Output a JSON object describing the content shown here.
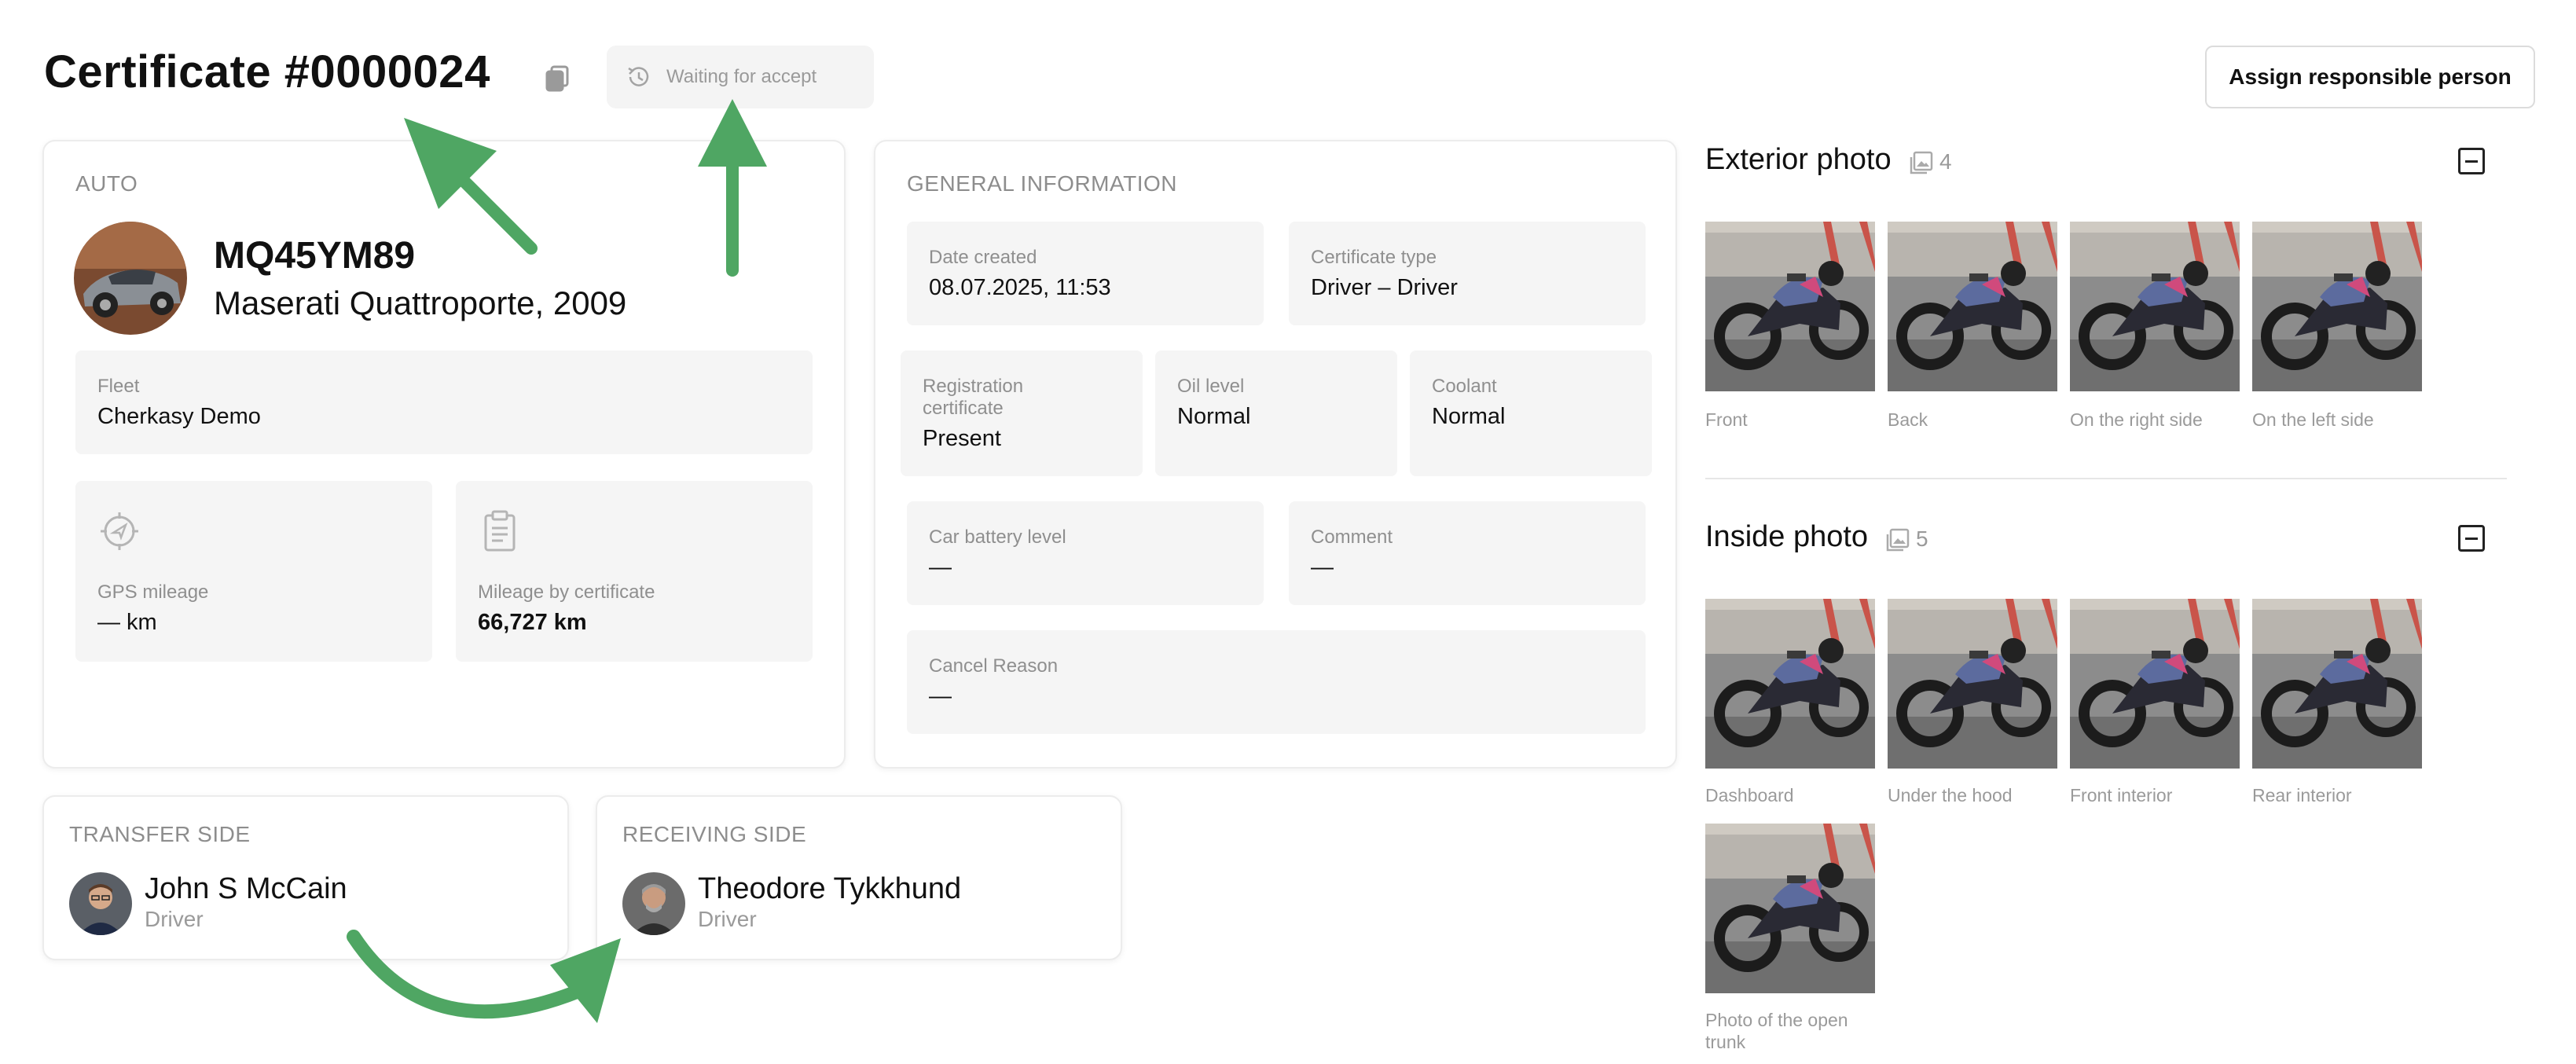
{
  "header": {
    "title": "Certificate #0000024",
    "status": "Waiting for accept",
    "assign_button": "Assign responsible person"
  },
  "auto": {
    "section_label": "AUTO",
    "plate": "MQ45YM89",
    "model": "Maserati Quattroporte, 2009",
    "fleet_label": "Fleet",
    "fleet_value": "Cherkasy Demo",
    "gps_label": "GPS mileage",
    "gps_value": "— km",
    "mileage_label": "Mileage by certificate",
    "mileage_value": "66,727 km"
  },
  "general": {
    "section_label": "GENERAL INFORMATION",
    "date_label": "Date created",
    "date_value": "08.07.2025, 11:53",
    "type_label": "Certificate type",
    "type_value": "Driver – Driver",
    "reg_label_1": "Registration",
    "reg_label_2": "certificate",
    "reg_value": "Present",
    "oil_label": "Oil level",
    "oil_value": "Normal",
    "coolant_label": "Coolant",
    "coolant_value": "Normal",
    "battery_label": "Car battery level",
    "battery_value": "—",
    "comment_label": "Comment",
    "comment_value": "—",
    "cancel_label": "Cancel Reason",
    "cancel_value": "—"
  },
  "transfer": {
    "section_label": "TRANSFER SIDE",
    "name": "John S McCain",
    "role": "Driver"
  },
  "receiving": {
    "section_label": "RECEIVING SIDE",
    "name": "Theodore Tykkhund",
    "role": "Driver"
  },
  "exterior": {
    "title": "Exterior photo",
    "count": "4",
    "photos": [
      "Front",
      "Back",
      "On the right side",
      "On the left side"
    ]
  },
  "inside": {
    "title": "Inside photo",
    "count": "5",
    "photos": [
      "Dashboard",
      "Under the hood",
      "Front interior",
      "Rear interior",
      "Photo of the open",
      "trunk"
    ]
  },
  "colors": {
    "arrow": "#4fa663",
    "tile_bg": "#f5f5f5",
    "muted_text": "#8d8d8d"
  },
  "icons": [
    "copy-icon",
    "history-icon",
    "gps-icon",
    "clipboard-icon",
    "gallery-icon",
    "collapse-icon"
  ]
}
